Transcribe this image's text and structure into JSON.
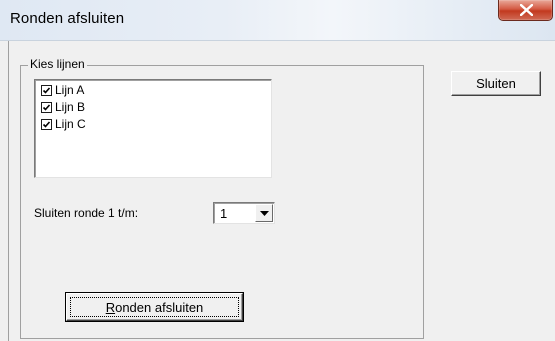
{
  "window": {
    "title": "Ronden afsluiten"
  },
  "group": {
    "label": "Kies lijnen",
    "lines": [
      {
        "label": "Lijn A",
        "checked": true
      },
      {
        "label": "Lijn B",
        "checked": true
      },
      {
        "label": "Lijn C",
        "checked": true
      }
    ]
  },
  "round_select": {
    "label": "Sluiten ronde 1 t/m:",
    "value": "1"
  },
  "buttons": {
    "close_label": "Sluiten",
    "finish_rounds_mnemonic": "R",
    "finish_rounds_rest": "onden afsluiten"
  },
  "icons": {
    "titlebar_close": "close-icon",
    "checkbox": "checkmark-icon",
    "dropdown": "chevron-down-icon"
  },
  "colors": {
    "close_button": "#c2391f",
    "window_bg": "#f0f0f0"
  }
}
